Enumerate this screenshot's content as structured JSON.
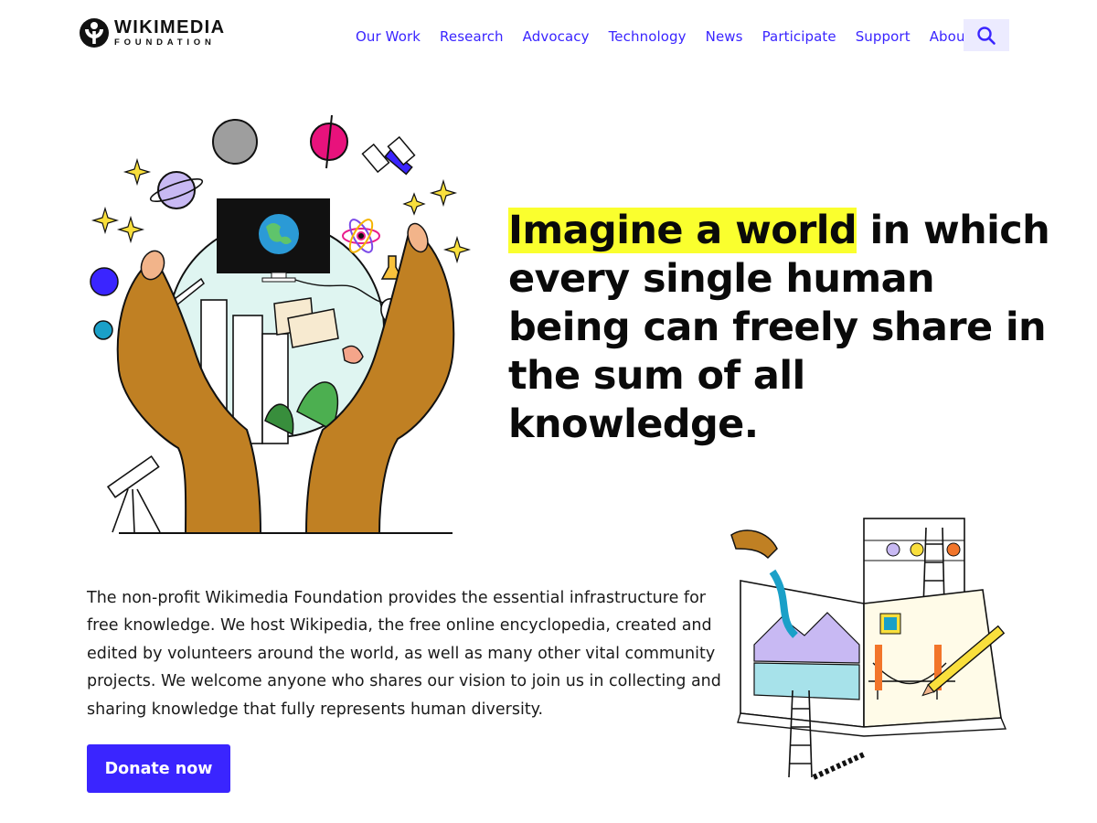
{
  "header": {
    "logo": {
      "title": "WIKIMEDIA",
      "subtitle": "FOUNDATION"
    },
    "nav": [
      {
        "label": "Our Work"
      },
      {
        "label": "Research"
      },
      {
        "label": "Advocacy"
      },
      {
        "label": "Technology"
      },
      {
        "label": "News"
      },
      {
        "label": "Participate"
      },
      {
        "label": "Support"
      },
      {
        "label": "About"
      }
    ],
    "search_icon": "search-icon"
  },
  "hero": {
    "headline_highlight": "Imagine a world",
    "headline_rest": " in which every single human being can freely share in the sum of all knowledge."
  },
  "intro": {
    "text": "The non-profit Wikimedia Foundation provides the essential infrastructure for free knowledge. We host Wikipedia, the free online encyclopedia, created and edited by volunteers around the world, as well as many other vital community projects. We welcome anyone who shares our vision to join us in collecting and sharing knowledge that fully represents human diversity."
  },
  "cta": {
    "donate_label": "Donate now"
  },
  "colors": {
    "accent": "#3a25ff",
    "highlight": "#faff2e",
    "search_bg": "#ecebff"
  }
}
